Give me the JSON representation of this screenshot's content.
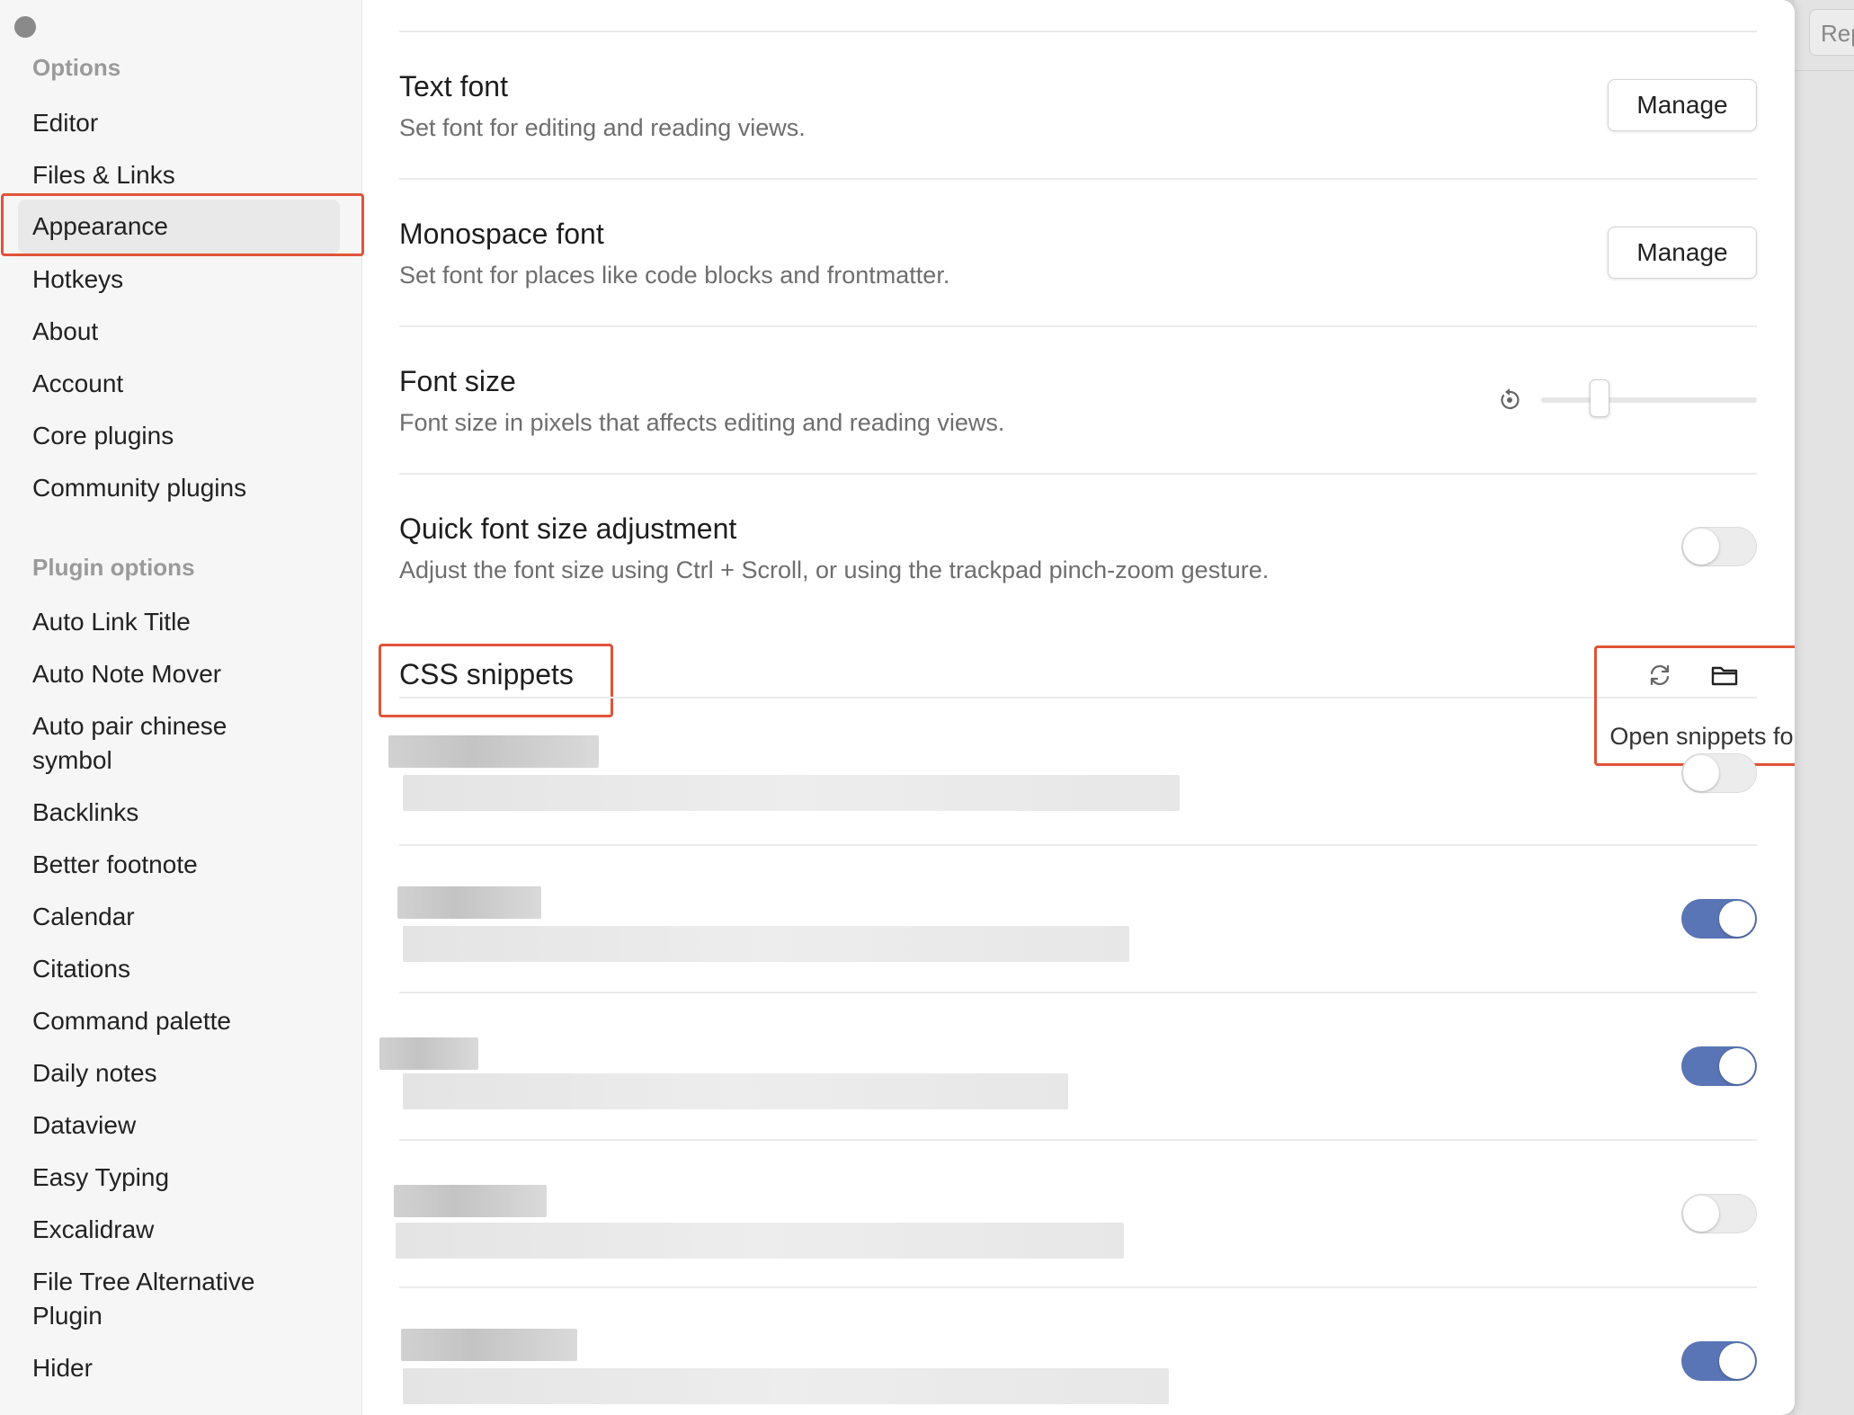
{
  "sidebar": {
    "options_header": "Options",
    "options": [
      {
        "label": "Editor"
      },
      {
        "label": "Files & Links"
      },
      {
        "label": "Appearance",
        "active": true
      },
      {
        "label": "Hotkeys"
      },
      {
        "label": "About"
      },
      {
        "label": "Account"
      },
      {
        "label": "Core plugins"
      },
      {
        "label": "Community plugins"
      }
    ],
    "plugin_header": "Plugin options",
    "plugins": [
      {
        "label": "Auto Link Title"
      },
      {
        "label": "Auto Note Mover"
      },
      {
        "label": "Auto pair chinese symbol"
      },
      {
        "label": "Backlinks"
      },
      {
        "label": "Better footnote"
      },
      {
        "label": "Calendar"
      },
      {
        "label": "Citations"
      },
      {
        "label": "Command palette"
      },
      {
        "label": "Daily notes"
      },
      {
        "label": "Dataview"
      },
      {
        "label": "Easy Typing"
      },
      {
        "label": "Excalidraw"
      },
      {
        "label": "File Tree Alternative Plugin"
      },
      {
        "label": "Hider"
      }
    ]
  },
  "settings": {
    "text_font": {
      "name": "Text font",
      "desc": "Set font for editing and reading views.",
      "button": "Manage"
    },
    "mono_font": {
      "name": "Monospace font",
      "desc": "Set font for places like code blocks and frontmatter.",
      "button": "Manage"
    },
    "font_size": {
      "name": "Font size",
      "desc": "Font size in pixels that affects editing and reading views.",
      "slider_fraction": 0.27
    },
    "quick_font": {
      "name": "Quick font size adjustment",
      "desc": "Adjust the font size using Ctrl + Scroll, or using the trackpad pinch-zoom gesture.",
      "enabled": false
    }
  },
  "css_snippets": {
    "header": "CSS snippets",
    "tooltip": "Open snippets folder",
    "icons": [
      "reload-icon",
      "folder-icon"
    ],
    "snippets": [
      {
        "enabled": false
      },
      {
        "enabled": true
      },
      {
        "enabled": true
      },
      {
        "enabled": false
      },
      {
        "enabled": true
      }
    ]
  },
  "background": {
    "partial_button": "Rep"
  },
  "colors": {
    "accent": "#5a75b5",
    "highlight": "#e0533a"
  }
}
